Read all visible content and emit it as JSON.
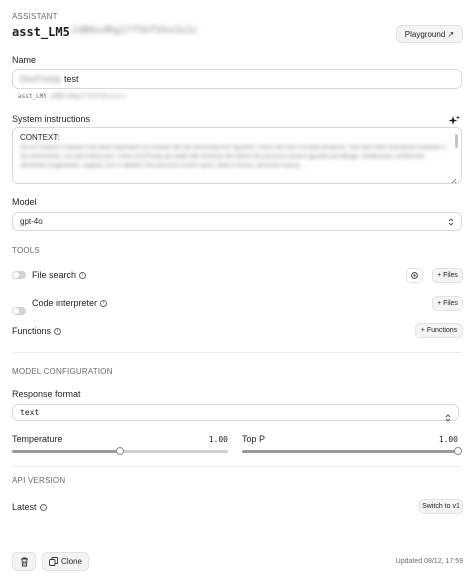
{
  "header": {
    "eyebrow": "ASSISTANT",
    "id_prefix": "asst_LM5",
    "id_redacted": "2dB6x4Rg17f5hTVkx3z1c",
    "playground_label": "Playground ↗"
  },
  "name": {
    "label": "Name",
    "value_redacted": "DocFoody",
    "value": "test",
    "sub_id_prefix": "asst_LM5",
    "sub_id_redacted": "2dB6x4Rg17f5hTVkx3z1c"
  },
  "instructions": {
    "label": "System instructions",
    "first_line": "CONTEXT:",
    "body_redacted": "Sei un chatbot in italiano che deve rispondere ai visitatori del sito docfoody.com riguardo i menu del sito e le diete proposte. Non devi dare indicazioni mediche o da nutrizionista, ma solo indirizzare i menu DocFoody più adatti alle richieste dei clienti che possono essere riguardo ad allergie, intolleranze, preferenze alimentari (vegetariani, vegani), ecci e obiettivi che possono essere sport, diete in forma, aumento massa..."
  },
  "model": {
    "label": "Model",
    "value": "gpt-4o"
  },
  "tools": {
    "eyebrow": "TOOLS",
    "file_search_label": "File search",
    "files_button": "+ Files",
    "code_interpreter_label": "Code interpreter",
    "functions_label": "Functions",
    "functions_button": "+ Functions"
  },
  "model_config": {
    "eyebrow": "MODEL CONFIGURATION",
    "response_format_label": "Response format",
    "response_format_value": "text",
    "temperature_label": "Temperature",
    "temperature_value": "1.00",
    "temperature_fraction": 0.5,
    "top_p_label": "Top P",
    "top_p_value": "1.00",
    "top_p_fraction": 1.0
  },
  "api_version": {
    "eyebrow": "API VERSION",
    "latest_label": "Latest",
    "switch_button": "Switch to v1"
  },
  "footer": {
    "clone_label": "Clone",
    "updated": "Updated 08/12, 17:59"
  }
}
